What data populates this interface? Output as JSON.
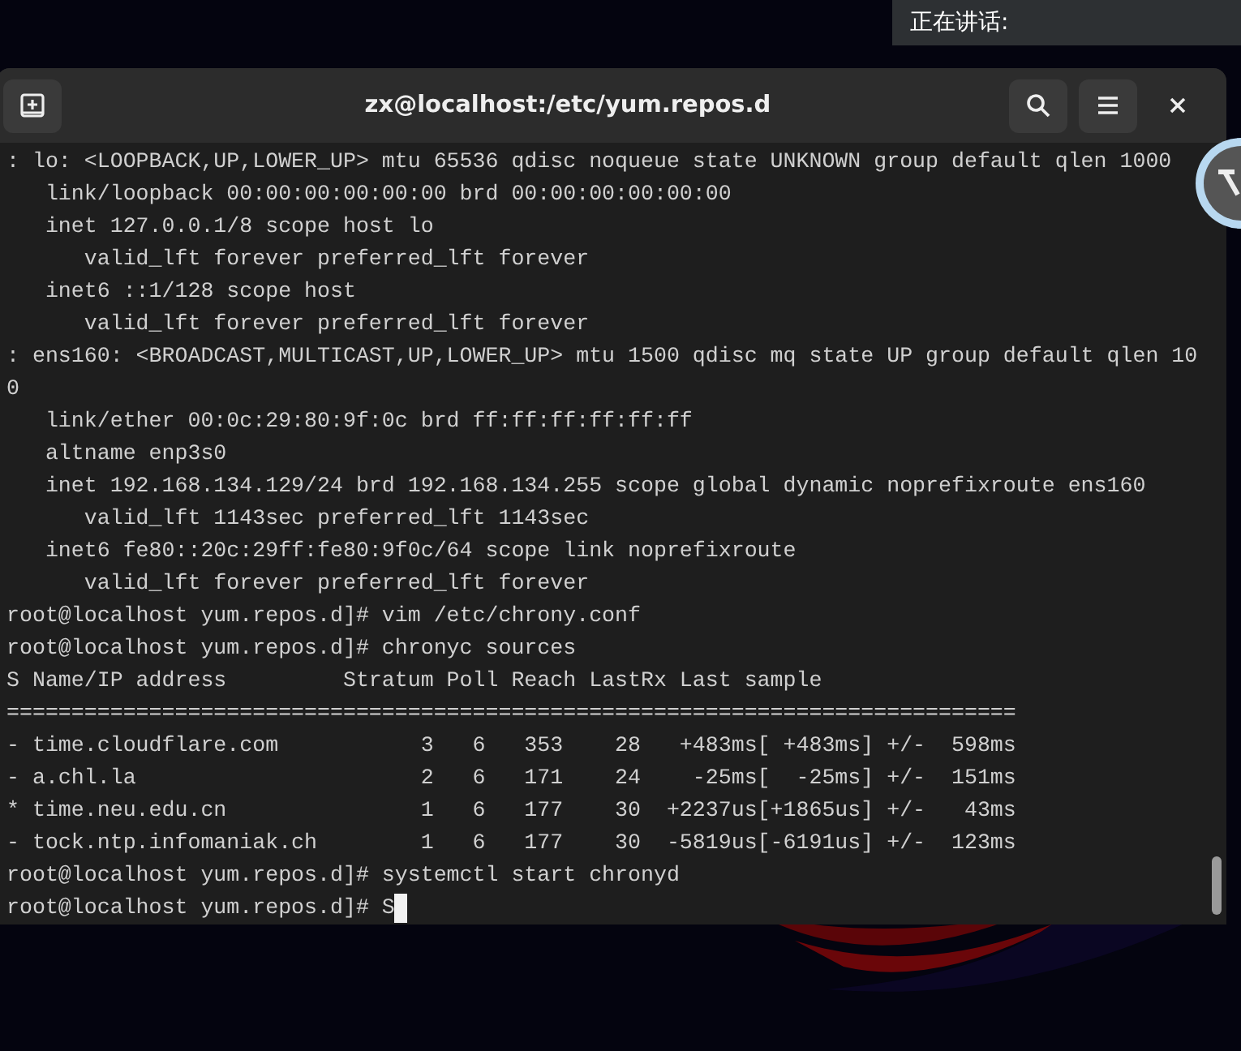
{
  "speaking_panel": {
    "label": "正在讲话:"
  },
  "window": {
    "title": "zx@localhost:/etc/yum.repos.d"
  },
  "terminal": {
    "lines": [
      ": lo: <LOOPBACK,UP,LOWER_UP> mtu 65536 qdisc noqueue state UNKNOWN group default qlen 1000",
      "   link/loopback 00:00:00:00:00:00 brd 00:00:00:00:00:00",
      "   inet 127.0.0.1/8 scope host lo",
      "      valid_lft forever preferred_lft forever",
      "   inet6 ::1/128 scope host",
      "      valid_lft forever preferred_lft forever",
      ": ens160: <BROADCAST,MULTICAST,UP,LOWER_UP> mtu 1500 qdisc mq state UP group default qlen 10",
      "0",
      "   link/ether 00:0c:29:80:9f:0c brd ff:ff:ff:ff:ff:ff",
      "   altname enp3s0",
      "   inet 192.168.134.129/24 brd 192.168.134.255 scope global dynamic noprefixroute ens160",
      "      valid_lft 1143sec preferred_lft 1143sec",
      "   inet6 fe80::20c:29ff:fe80:9f0c/64 scope link noprefixroute",
      "      valid_lft forever preferred_lft forever",
      "root@localhost yum.repos.d]# vim /etc/chrony.conf",
      "root@localhost yum.repos.d]# chronyc sources",
      "S Name/IP address         Stratum Poll Reach LastRx Last sample",
      "==============================================================================",
      "- time.cloudflare.com           3   6   353    28   +483ms[ +483ms] +/-  598ms",
      "- a.chl.la                      2   6   171    24    -25ms[  -25ms] +/-  151ms",
      "* time.neu.edu.cn               1   6   177    30  +2237us[+1865us] +/-   43ms",
      "- tock.ntp.infomaniak.ch        1   6   177    30  -5819us[-6191us] +/-  123ms",
      "root@localhost yum.repos.d]# systemctl start chronyd",
      "root@localhost yum.repos.d]# S"
    ]
  }
}
